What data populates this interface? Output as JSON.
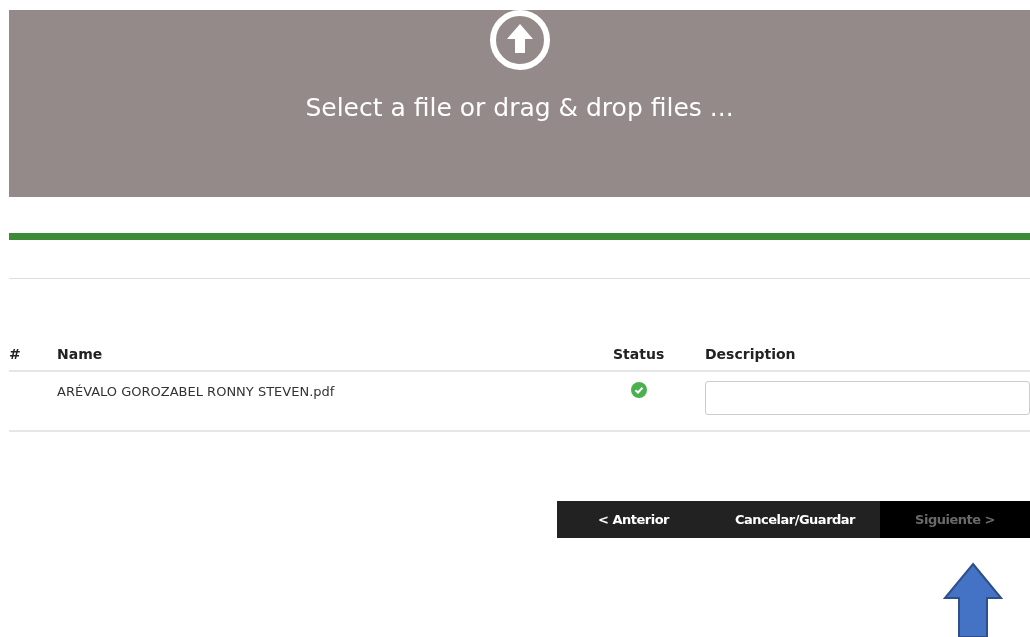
{
  "dropzone": {
    "label": "Select a file or drag & drop files ..."
  },
  "progress": {
    "level": 1
  },
  "table": {
    "columns": [
      "#",
      "Name",
      "Status",
      "Description"
    ],
    "rows": [
      {
        "name": "ARÉVALO GOROZABEL RONNY STEVEN.pdf",
        "uploaded": true
      }
    ]
  },
  "buttons": [
    {
      "label": "< Anterior",
      "disabled": false
    },
    {
      "label": "Cancelar/Guardar",
      "disabled": false
    },
    {
      "label": "Siguiente >",
      "disabled": true
    }
  ]
}
